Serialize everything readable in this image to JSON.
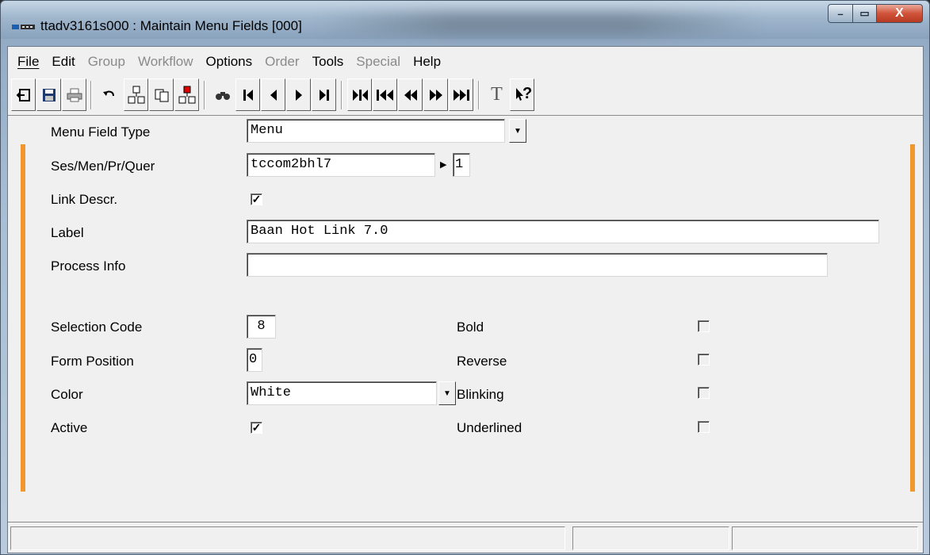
{
  "window": {
    "title": "ttadv3161s000 : Maintain Menu Fields [000]",
    "buttons": {
      "minimize": "–",
      "maximize": "▭",
      "close": "X"
    }
  },
  "menubar": {
    "items": [
      {
        "label": "File",
        "enabled": true
      },
      {
        "label": "Edit",
        "enabled": true
      },
      {
        "label": "Group",
        "enabled": false
      },
      {
        "label": "Workflow",
        "enabled": false
      },
      {
        "label": "Options",
        "enabled": true
      },
      {
        "label": "Order",
        "enabled": false
      },
      {
        "label": "Tools",
        "enabled": true
      },
      {
        "label": "Special",
        "enabled": false
      },
      {
        "label": "Help",
        "enabled": true
      }
    ]
  },
  "toolbar": {
    "icons": [
      "exit-icon",
      "save-icon",
      "print-icon",
      "undo-icon",
      "insert-icon",
      "copy-icon",
      "duplicate-icon",
      "find-icon",
      "first-record-icon",
      "previous-record-icon",
      "next-record-icon",
      "last-record-icon",
      "first-set-icon",
      "previous-set-icon",
      "fast-previous-icon",
      "fast-next-icon",
      "next-set-icon",
      "text-icon",
      "help-icon"
    ],
    "text_glyph": "T",
    "help_glyph": "?"
  },
  "form": {
    "menu_field_type": {
      "label": "Menu Field Type",
      "value": "Menu"
    },
    "ses_men_pr_quer": {
      "label": "Ses/Men/Pr/Quer",
      "value": "tccom2bhl7",
      "extra": "1"
    },
    "link_descr": {
      "label": "Link Descr.",
      "checked": true
    },
    "label": {
      "label": "Label",
      "value": "Baan Hot Link 7.0"
    },
    "process_info": {
      "label": "Process Info",
      "value": ""
    },
    "selection_code": {
      "label": "Selection Code",
      "value": "8"
    },
    "form_position": {
      "label": "Form Position",
      "value": "0"
    },
    "color": {
      "label": "Color",
      "value": "White"
    },
    "active": {
      "label": "Active",
      "checked": true
    },
    "bold": {
      "label": "Bold",
      "checked": false
    },
    "reverse": {
      "label": "Reverse",
      "checked": false
    },
    "blinking": {
      "label": "Blinking",
      "checked": false
    },
    "underlined": {
      "label": "Underlined",
      "checked": false
    }
  },
  "colors": {
    "accent": "#f0972d",
    "face": "#f0f0f0"
  }
}
